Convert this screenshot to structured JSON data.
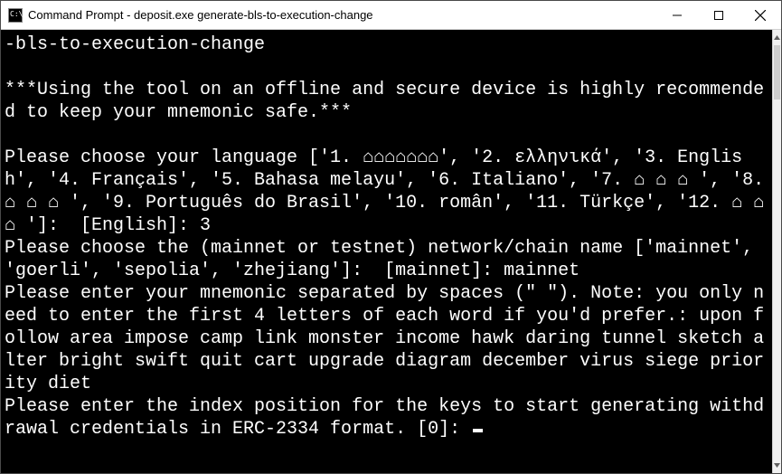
{
  "window": {
    "title": "Command Prompt - deposit.exe  generate-bls-to-execution-change"
  },
  "terminal": {
    "lines": [
      "-bls-to-execution-change",
      "",
      "***Using the tool on an offline and secure device is highly recommended to keep your mnemonic safe.***",
      "",
      "Please choose your language ['1. ⌂⌂⌂⌂⌂⌂⌂', '2. ελληνικά', '3. English', '4. Français', '5. Bahasa melayu', '6. Italiano', '7. ⌂ ⌂ ⌂ ', '8. ⌂ ⌂ ⌂ ', '9. Português do Brasil', '10. român', '11. Türkçe', '12. ⌂ ⌂ ⌂ ']:  [English]: 3",
      "Please choose the (mainnet or testnet) network/chain name ['mainnet', 'goerli', 'sepolia', 'zhejiang']:  [mainnet]: mainnet",
      "Please enter your mnemonic separated by spaces (\" \"). Note: you only need to enter the first 4 letters of each word if you'd prefer.: upon follow area impose camp link monster income hawk daring tunnel sketch alter bright swift quit cart upgrade diagram december virus siege priority diet"
    ],
    "prompt_line": "Please enter the index position for the keys to start generating withdrawal credentials in ERC-2334 format. [0]: "
  }
}
